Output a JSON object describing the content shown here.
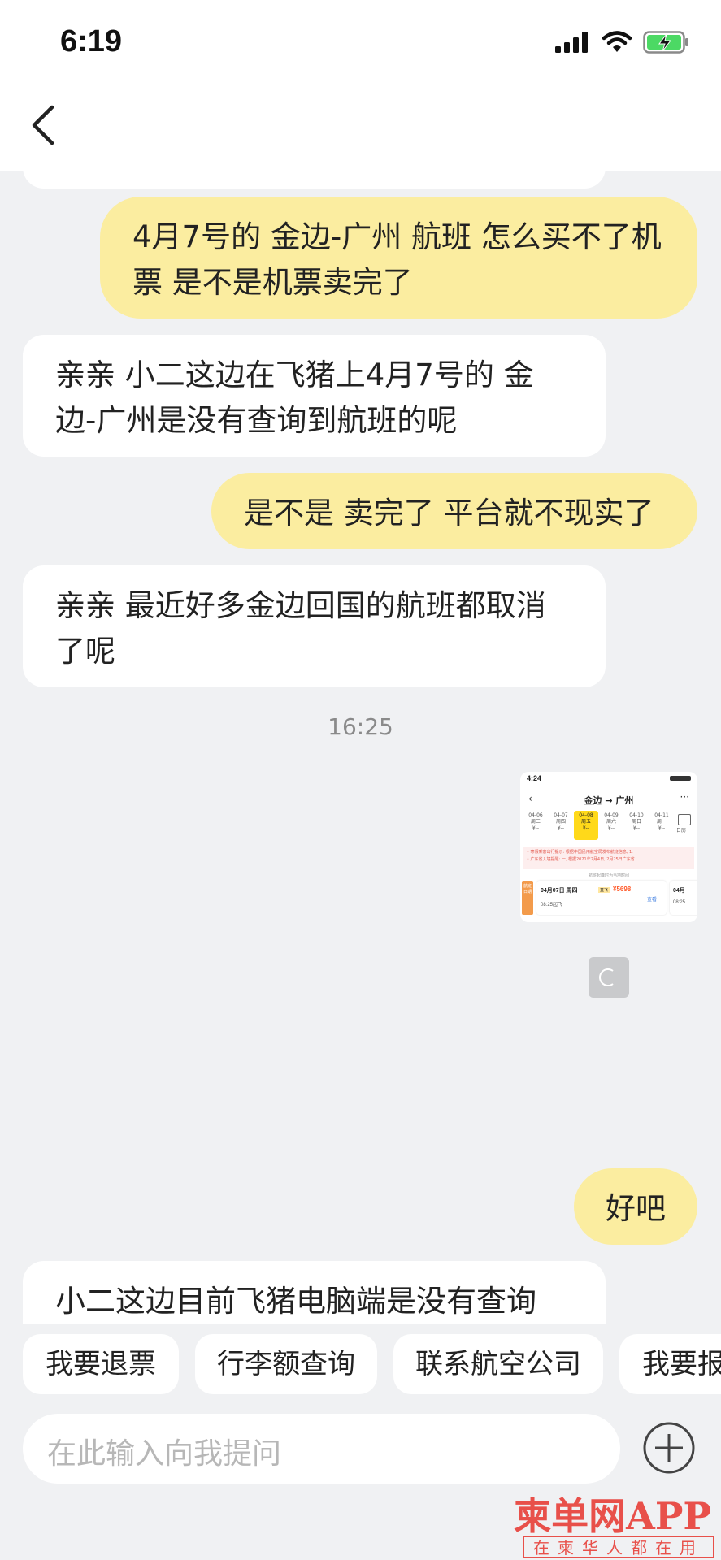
{
  "status": {
    "time": "6:19"
  },
  "messages": [
    {
      "side": "right",
      "text": "4月7号的 金边-广州 航班 怎么买不了机票 是不是机票卖完了"
    },
    {
      "side": "left",
      "text": "亲亲 小二这边在飞猪上4月7号的 金边-广州是没有查询到航班的呢"
    },
    {
      "side": "right",
      "text": "是不是 卖完了 平台就不现实了"
    },
    {
      "side": "left",
      "text": "亲亲 最近好多金边回国的航班都取消了呢"
    },
    {
      "side": "right",
      "text": "好吧"
    },
    {
      "side": "left",
      "text": "小二这边目前飞猪电脑端是没有查询"
    }
  ],
  "timestamp": "16:25",
  "screenshot_thumb": {
    "status_time": "4:24",
    "route": "金边 → 广州",
    "dates": [
      {
        "d": "04-06",
        "w": "周三",
        "p": "¥--"
      },
      {
        "d": "04-07",
        "w": "周四",
        "p": "¥--"
      },
      {
        "d": "04-08",
        "w": "周五",
        "p": "¥--",
        "active": true
      },
      {
        "d": "04-09",
        "w": "周六",
        "p": "¥--"
      },
      {
        "d": "04-10",
        "w": "周日",
        "p": "¥--"
      },
      {
        "d": "04-11",
        "w": "周一",
        "p": "¥--"
      }
    ],
    "calendar_label": "日历",
    "notice1": "• 寒假乘客出行提示: 根据中国民用航空局发布航班信息, 1.",
    "notice2": "• 广东省入境提醒: 一, 根据2021年2月4日, 2月25日广东省...",
    "section_label": "航班起降时为当地时间",
    "side_tag": "航班日期",
    "card_date": "04月07日 周四",
    "card_badge": "直飞",
    "card_price": "¥5698",
    "card_time": "08:25起飞",
    "card_link": "查看",
    "card2_date": "04月",
    "card2_time": "08:25"
  },
  "quick_actions": [
    "我要退票",
    "行李额查询",
    "联系航空公司",
    "我要报"
  ],
  "input": {
    "placeholder": "在此输入向我提问"
  },
  "watermark": {
    "title": "柬单网APP",
    "subtitle": "在柬华人都在用"
  }
}
